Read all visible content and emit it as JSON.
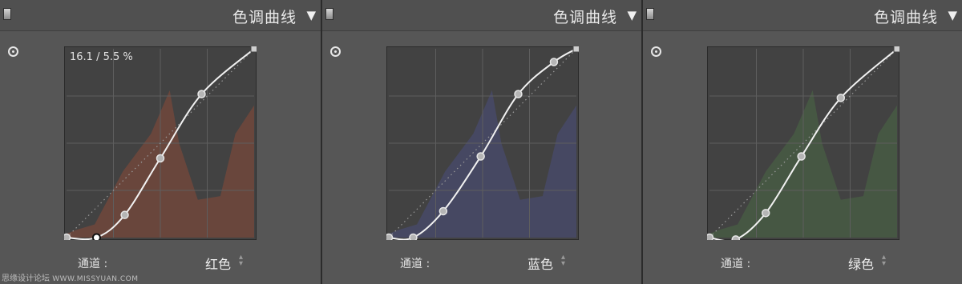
{
  "panels": [
    {
      "title": "色调曲线",
      "readout": "16.1 / 5.5 %",
      "channel_label": "通道 :",
      "channel_value": "红色",
      "tint": "#8a4a38",
      "curve_points": [
        [
          0,
          0
        ],
        [
          0.16,
          0
        ],
        [
          0.31,
          0.12
        ],
        [
          0.5,
          0.42
        ],
        [
          0.72,
          0.76
        ],
        [
          1,
          1
        ]
      ],
      "highlight_point": 1
    },
    {
      "title": "色调曲线",
      "channel_label": "通道 :",
      "channel_value": "蓝色",
      "tint": "#4a4f7e",
      "curve_points": [
        [
          0,
          0
        ],
        [
          0.13,
          0
        ],
        [
          0.29,
          0.14
        ],
        [
          0.49,
          0.43
        ],
        [
          0.69,
          0.76
        ],
        [
          0.88,
          0.93
        ],
        [
          1,
          1
        ]
      ]
    },
    {
      "title": "色调曲线",
      "channel_label": "通道 :",
      "channel_value": "绿色",
      "tint": "#4a6a46",
      "curve_points": [
        [
          0,
          0
        ],
        [
          0.14,
          -0.01
        ],
        [
          0.3,
          0.13
        ],
        [
          0.49,
          0.43
        ],
        [
          0.7,
          0.74
        ],
        [
          1,
          1
        ]
      ]
    }
  ],
  "watermark": {
    "text": "思缘设计论坛",
    "site": "WWW.MISSYUAN.COM"
  }
}
